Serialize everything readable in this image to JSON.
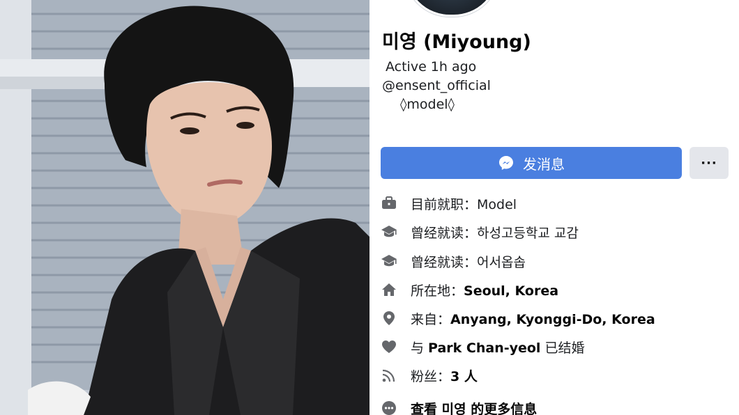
{
  "profile": {
    "name": "미영 (Miyoung)",
    "active_status": "Active 1h ago",
    "handle": "@ensent_official",
    "bio": "◊model◊"
  },
  "actions": {
    "message_label": "发消息",
    "more_label": "···"
  },
  "info": {
    "work_prefix": "目前就职：",
    "work_value": "Model",
    "study1_prefix": "曾经就读：",
    "study1_value": "하성고등학교 교감",
    "study2_prefix": "曾经就读：",
    "study2_value": "어서옵솝",
    "lives_prefix": "所在地：",
    "lives_value": "Seoul, Korea",
    "from_prefix": "来自：",
    "from_value": "Anyang, Kyonggi-Do, Korea",
    "rel_prefix": "与 ",
    "rel_person": "Park Chan-yeol",
    "rel_suffix": " 已结婚",
    "followers_prefix": "粉丝：",
    "followers_value": "3 人",
    "more_prefix": "查看 ",
    "more_name": "미영",
    "more_suffix": " 的更多信息"
  },
  "icons": {
    "work": "briefcase-icon",
    "study1": "graduation-cap-icon",
    "study2": "graduation-cap-icon",
    "lives": "home-icon",
    "from": "location-pin-icon",
    "relationship": "heart-icon",
    "followers": "rss-icon",
    "more": "more-circle-icon",
    "message": "messenger-icon"
  },
  "colors": {
    "primary_button": "#4a7fe0",
    "secondary_button": "#e4e6eb",
    "icon_gray": "#65676b",
    "text": "#050505"
  }
}
